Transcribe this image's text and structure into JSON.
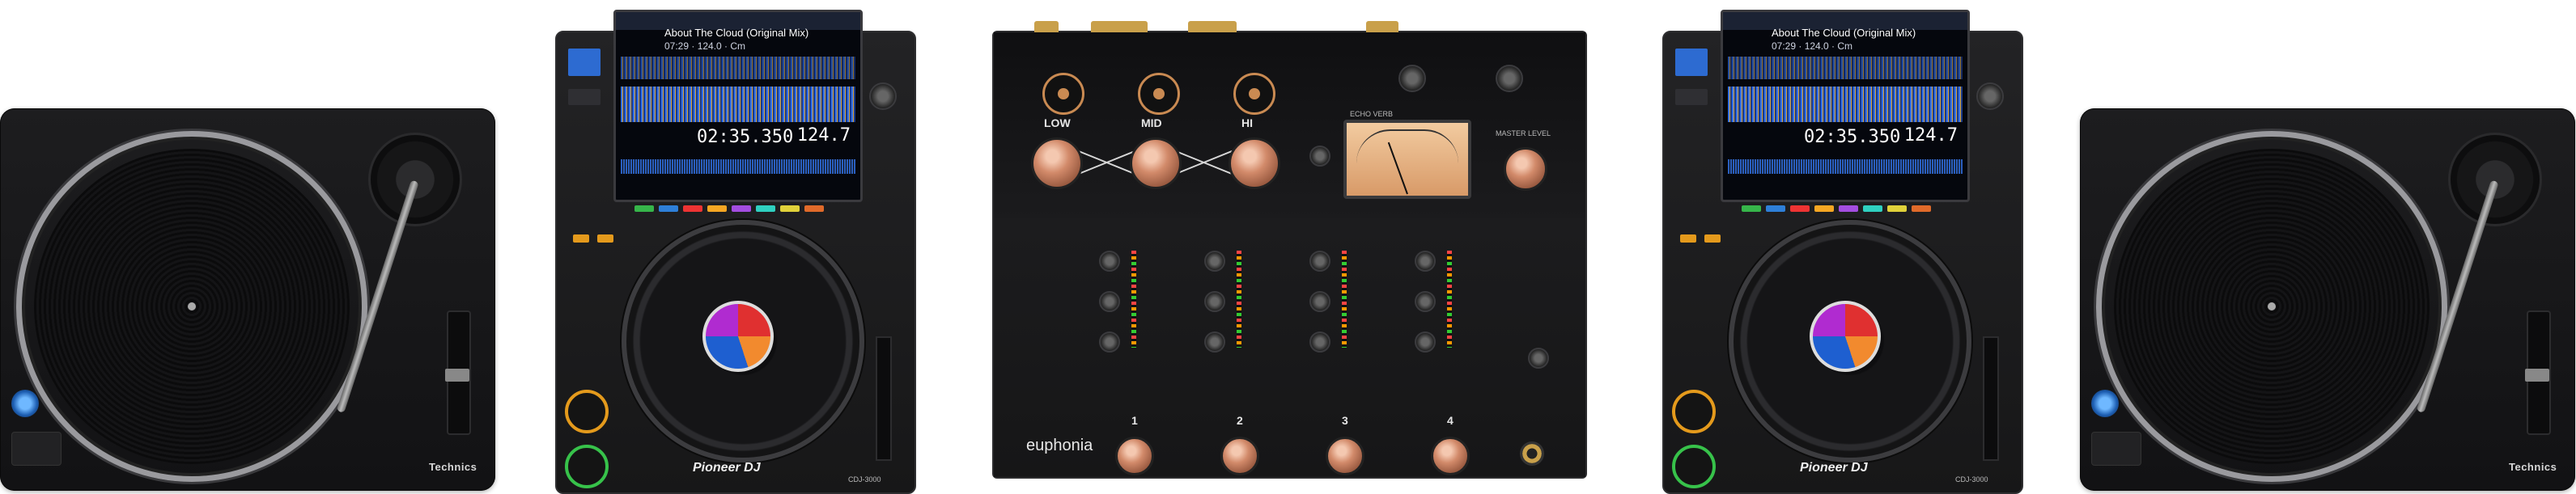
{
  "turntable": {
    "brand": "Technics"
  },
  "cdj": {
    "track_title": "About The Cloud (Original Mix)",
    "track_info": "07:29 · 124.0 · Cm",
    "time_remaining": "02:35.350",
    "bpm": "124.7",
    "brand": "Pioneer DJ",
    "model": "CDJ-3000"
  },
  "mixer": {
    "brand": "euphonia",
    "eq_labels": [
      "LOW",
      "MID",
      "HI"
    ],
    "effect_label": "ECHO VERB",
    "master_label": "MASTER LEVEL",
    "channel_numbers": [
      "1",
      "2",
      "3",
      "4"
    ]
  },
  "colors": {
    "copper": "#d28a6a",
    "pioneer_orange": "#e49a1c",
    "pioneer_green": "#37c24a",
    "turntable_led": "#1e5fb3"
  }
}
